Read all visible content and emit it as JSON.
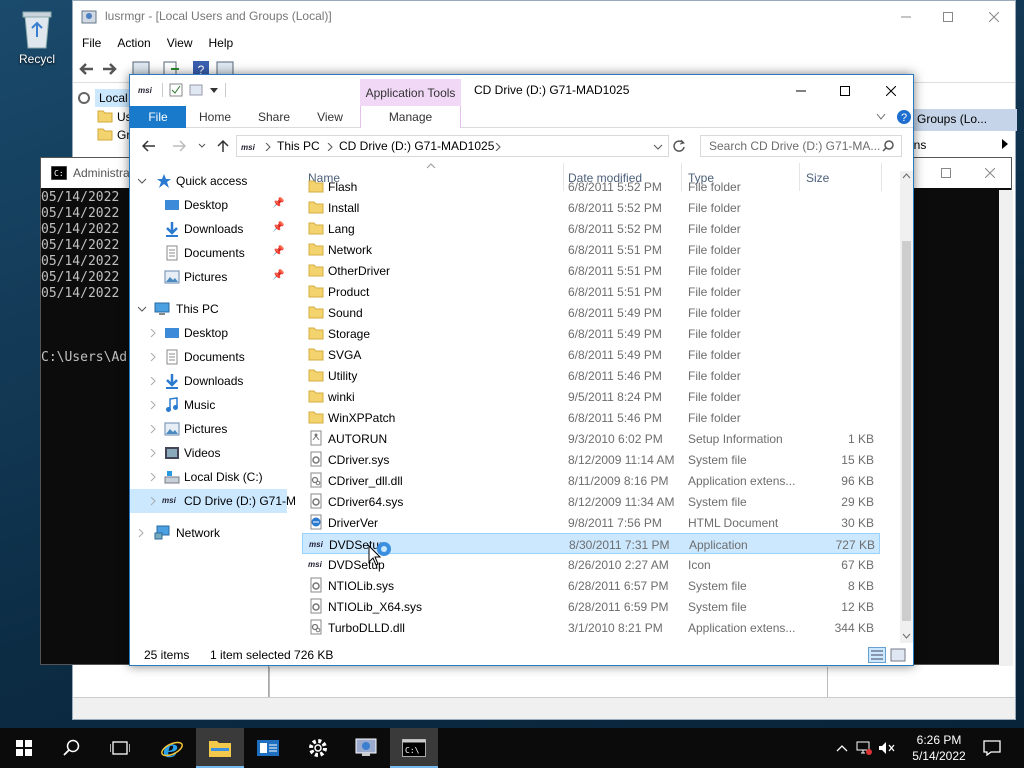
{
  "desktop": {
    "recycle_bin_label": "Recycl"
  },
  "lusrmgr": {
    "title": "lusrmgr - [Local Users and Groups (Local)]",
    "menu": [
      "File",
      "Action",
      "View",
      "Help"
    ],
    "tree_items": [
      "Local",
      "Us",
      "Gr"
    ],
    "right_header": "d Groups (Lo...",
    "right_sub": "ons"
  },
  "cmd": {
    "title": "Administra",
    "lines": [
      "05/14/2022",
      "05/14/2022",
      "05/14/2022",
      "05/14/2022",
      "05/14/2022",
      "05/14/2022",
      "05/14/2022"
    ],
    "prompt": "C:\\Users\\Ad"
  },
  "explorer": {
    "context_tab": "Application Tools",
    "context_sub": "Manage",
    "title": "CD Drive (D:) G71-MAD1025",
    "ribbon_tabs": [
      "File",
      "Home",
      "Share",
      "View"
    ],
    "address": {
      "this_pc": "This PC",
      "drive": "CD Drive (D:) G71-MAD1025"
    },
    "search_placeholder": "Search CD Drive (D:) G71-MA...",
    "columns": {
      "name": "Name",
      "date": "Date modified",
      "type": "Type",
      "size": "Size"
    },
    "nav": {
      "quick_access": "Quick access",
      "qa_items": [
        "Desktop",
        "Downloads",
        "Documents",
        "Pictures"
      ],
      "this_pc": "This PC",
      "pc_items": [
        "Desktop",
        "Documents",
        "Downloads",
        "Music",
        "Pictures",
        "Videos",
        "Local Disk (C:)",
        "CD Drive (D:) G71-M"
      ],
      "network": "Network"
    },
    "files": [
      {
        "name": "Flash",
        "date": "6/8/2011 5:52 PM",
        "type": "File folder",
        "size": "",
        "kind": "folder"
      },
      {
        "name": "Install",
        "date": "6/8/2011 5:52 PM",
        "type": "File folder",
        "size": "",
        "kind": "folder"
      },
      {
        "name": "Lang",
        "date": "6/8/2011 5:52 PM",
        "type": "File folder",
        "size": "",
        "kind": "folder"
      },
      {
        "name": "Network",
        "date": "6/8/2011 5:51 PM",
        "type": "File folder",
        "size": "",
        "kind": "folder"
      },
      {
        "name": "OtherDriver",
        "date": "6/8/2011 5:51 PM",
        "type": "File folder",
        "size": "",
        "kind": "folder"
      },
      {
        "name": "Product",
        "date": "6/8/2011 5:51 PM",
        "type": "File folder",
        "size": "",
        "kind": "folder"
      },
      {
        "name": "Sound",
        "date": "6/8/2011 5:49 PM",
        "type": "File folder",
        "size": "",
        "kind": "folder"
      },
      {
        "name": "Storage",
        "date": "6/8/2011 5:49 PM",
        "type": "File folder",
        "size": "",
        "kind": "folder"
      },
      {
        "name": "SVGA",
        "date": "6/8/2011 5:49 PM",
        "type": "File folder",
        "size": "",
        "kind": "folder"
      },
      {
        "name": "Utility",
        "date": "6/8/2011 5:46 PM",
        "type": "File folder",
        "size": "",
        "kind": "folder"
      },
      {
        "name": "winki",
        "date": "9/5/2011 8:24 PM",
        "type": "File folder",
        "size": "",
        "kind": "folder"
      },
      {
        "name": "WinXPPatch",
        "date": "6/8/2011 5:46 PM",
        "type": "File folder",
        "size": "",
        "kind": "folder"
      },
      {
        "name": "AUTORUN",
        "date": "9/3/2010 6:02 PM",
        "type": "Setup Information",
        "size": "1 KB",
        "kind": "inf"
      },
      {
        "name": "CDriver.sys",
        "date": "8/12/2009 11:14 AM",
        "type": "System file",
        "size": "15 KB",
        "kind": "sys"
      },
      {
        "name": "CDriver_dll.dll",
        "date": "8/11/2009 8:16 PM",
        "type": "Application extens...",
        "size": "96 KB",
        "kind": "dll"
      },
      {
        "name": "CDriver64.sys",
        "date": "8/12/2009 11:34 AM",
        "type": "System file",
        "size": "29 KB",
        "kind": "sys"
      },
      {
        "name": "DriverVer",
        "date": "9/8/2011 7:56 PM",
        "type": "HTML Document",
        "size": "30 KB",
        "kind": "html"
      },
      {
        "name": "DVDSetup",
        "date": "8/30/2011 7:31 PM",
        "type": "Application",
        "size": "727 KB",
        "kind": "msi"
      },
      {
        "name": "DVDSetup",
        "date": "8/26/2010 2:27 AM",
        "type": "Icon",
        "size": "67 KB",
        "kind": "msi"
      },
      {
        "name": "NTIOLib.sys",
        "date": "6/28/2011 6:57 PM",
        "type": "System file",
        "size": "8 KB",
        "kind": "sys"
      },
      {
        "name": "NTIOLib_X64.sys",
        "date": "6/28/2011 6:59 PM",
        "type": "System file",
        "size": "12 KB",
        "kind": "sys"
      },
      {
        "name": "TurboDLLD.dll",
        "date": "3/1/2010 8:21 PM",
        "type": "Application extens...",
        "size": "344 KB",
        "kind": "dll"
      }
    ],
    "selected_index": 17,
    "status": {
      "items": "25 items",
      "selection": "1 item selected  726 KB"
    }
  },
  "taskbar": {
    "time": "6:26 PM",
    "date": "5/14/2022"
  },
  "colors": {
    "accent": "#1979ca",
    "selection": "#cce8ff",
    "context_tab": "#f1d8f7"
  }
}
